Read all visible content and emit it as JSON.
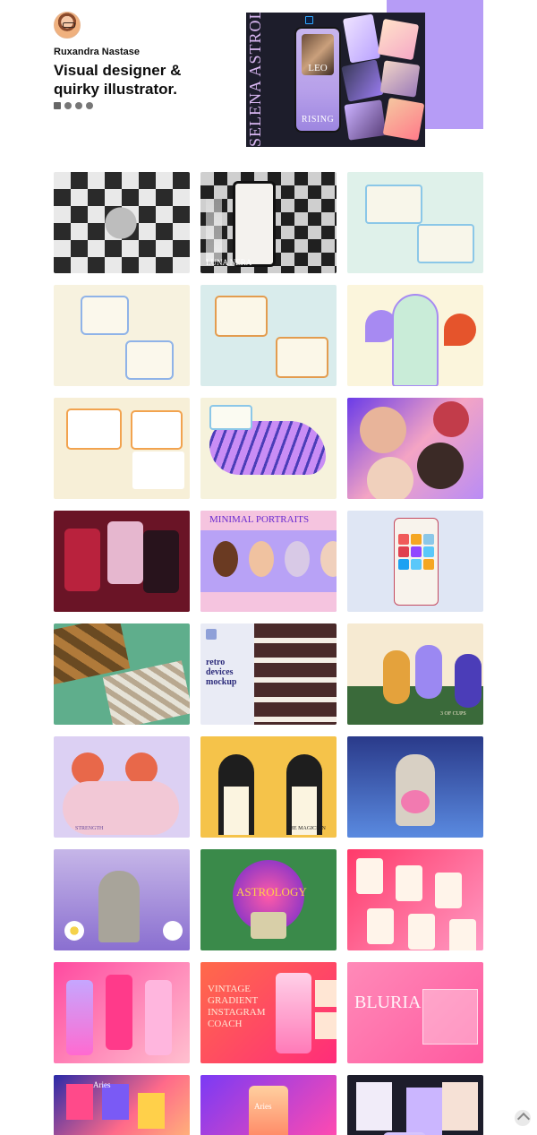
{
  "profile": {
    "name": "Ruxandra Nastase",
    "tagline_line1": "Visual designer &",
    "tagline_line2": "quirky illustrator.",
    "social_icons": [
      "mail-icon",
      "dribbble-icon",
      "behance-icon",
      "instagram-icon"
    ]
  },
  "hero": {
    "vertical_title": "SELENA ASTROLOGY INSTAGRAM",
    "sign_label": "LEO",
    "rising_label": "RISING",
    "badge": "Ps",
    "accent_color": "#b69cf6"
  },
  "gallery": {
    "tiles": [
      {
        "name": "luna-nera-checker-tile",
        "label": ""
      },
      {
        "name": "luna-nera-social-pack-tile",
        "label": "LUNA NERA"
      },
      {
        "name": "seafoam-posts-tile",
        "label": ""
      },
      {
        "name": "cream-bubble-posts-tile",
        "label": ""
      },
      {
        "name": "mint-tips-posts-tile",
        "label": ""
      },
      {
        "name": "flower-house-illustration-tile",
        "label": ""
      },
      {
        "name": "warm-food-posts-tile",
        "label": ""
      },
      {
        "name": "tiger-posts-tile",
        "label": ""
      },
      {
        "name": "faces-pattern-tile",
        "label": ""
      },
      {
        "name": "maroon-app-screens-tile",
        "label": ""
      },
      {
        "name": "minimal-portraits-tile",
        "label": "MINIMAL PORTRAITS"
      },
      {
        "name": "app-icons-grid-tile",
        "label": ""
      },
      {
        "name": "photo-feed-mockup-tile",
        "label": ""
      },
      {
        "name": "retro-devices-mockup-tile",
        "label": "retro devices mockup"
      },
      {
        "name": "dancers-illustration-tile",
        "label": "3 OF CUPS"
      },
      {
        "name": "strength-tarot-tile",
        "label": "STRENGTH"
      },
      {
        "name": "magician-tarot-tile",
        "label": "THE MAGICIAN"
      },
      {
        "name": "statue-collage-tile",
        "label": ""
      },
      {
        "name": "venus-collage-tile",
        "label": ""
      },
      {
        "name": "astrology-collage-tile",
        "label": "ASTROLOGY"
      },
      {
        "name": "pink-gradient-grid-tile",
        "label": ""
      },
      {
        "name": "gradient-phones-tile",
        "label": ""
      },
      {
        "name": "vintage-gradient-instagram-tile",
        "label": "VINTAGE GRADIENT INSTAGRAM COACH"
      },
      {
        "name": "bluria-tile",
        "label": "BLURIA"
      },
      {
        "name": "aries-posts-tile",
        "label": "Aries"
      },
      {
        "name": "blurry-gradient-tile",
        "label": "Aries"
      },
      {
        "name": "selena-posts-tile",
        "label": ""
      }
    ]
  },
  "back_to_top": {
    "icon": "arrow-up-icon"
  }
}
